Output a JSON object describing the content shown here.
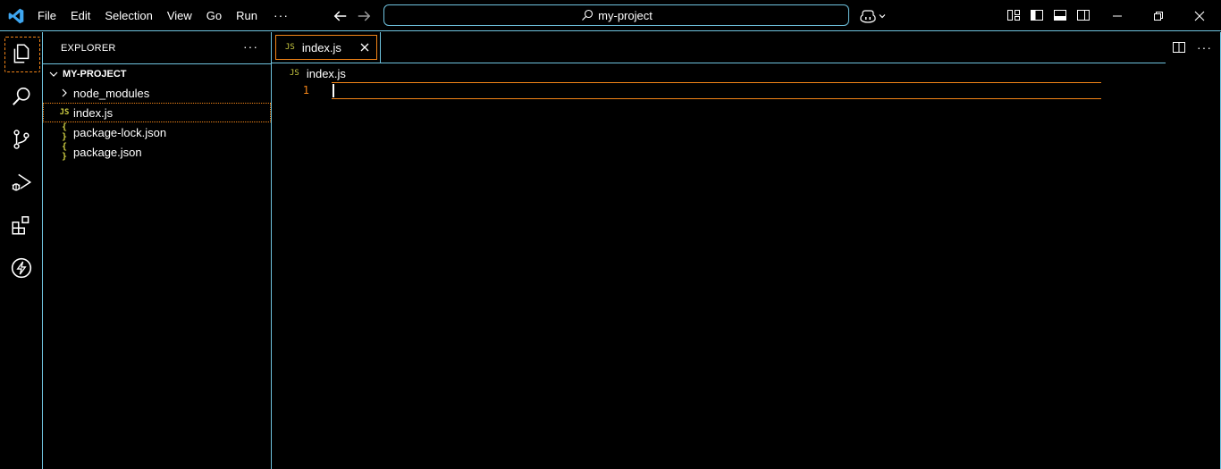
{
  "titlebar": {
    "menus": [
      "File",
      "Edit",
      "Selection",
      "View",
      "Go",
      "Run"
    ],
    "more": "···",
    "search_text": "my-project",
    "icons": [
      "vscode-logo-icon",
      "arrow-left-icon",
      "arrow-right-icon",
      "search-icon",
      "copilot-icon",
      "chevron-down-icon",
      "customize-layout-icon",
      "toggle-primary-sidebar-icon",
      "toggle-panel-icon",
      "toggle-secondary-sidebar-icon",
      "minimize-icon",
      "restore-icon",
      "close-icon"
    ]
  },
  "activitybar": {
    "items": [
      "explorer-icon",
      "search-icon",
      "source-control-icon",
      "run-debug-icon",
      "extensions-icon",
      "lightning-icon"
    ],
    "active": "explorer-icon"
  },
  "sidebar": {
    "title": "EXPLORER",
    "more": "···",
    "section_title": "MY-PROJECT",
    "tree": [
      {
        "label": "node_modules",
        "type": "folder",
        "icon": "chevron-right-icon"
      },
      {
        "label": "index.js",
        "type": "js",
        "icon_text": "JS",
        "selected": true
      },
      {
        "label": "package-lock.json",
        "type": "json",
        "icon_text": "{ }"
      },
      {
        "label": "package.json",
        "type": "json",
        "icon_text": "{ }"
      }
    ]
  },
  "editor": {
    "tab": {
      "label": "index.js",
      "icon_text": "JS"
    },
    "breadcrumb": {
      "label": "index.js",
      "icon_text": "JS"
    },
    "line_numbers": [
      "1"
    ],
    "more": "···"
  },
  "colors": {
    "background": "#000000",
    "contrast_border": "#6fc3df",
    "active_border": "#f38518",
    "js_icon": "#cbcb41"
  }
}
